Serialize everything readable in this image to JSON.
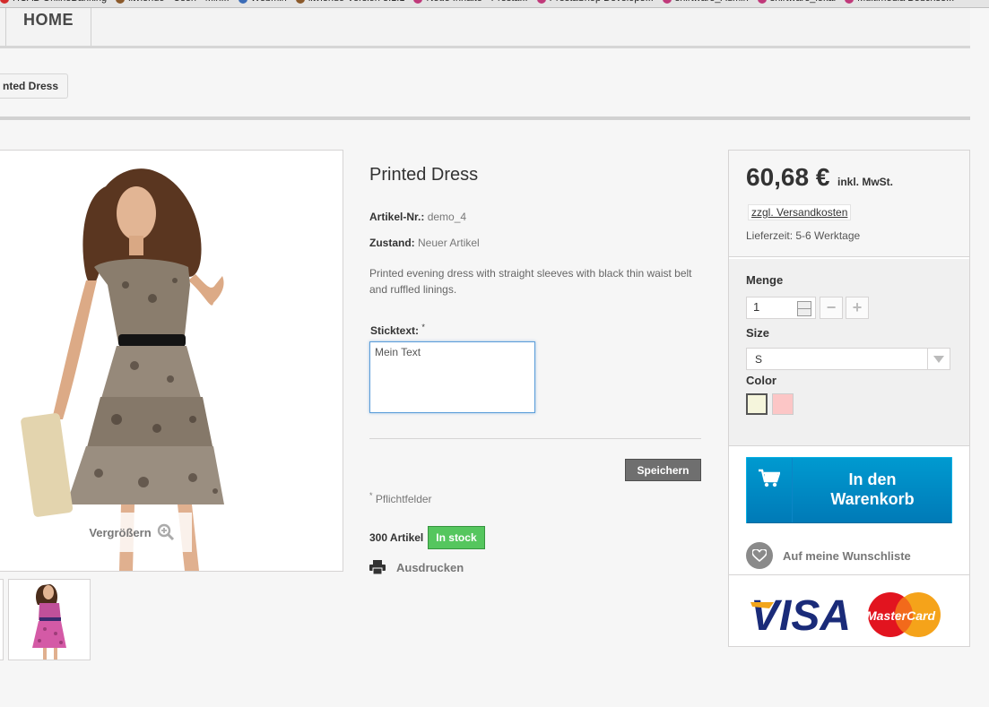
{
  "bookmarks": [
    {
      "label": "HCAB OnlineBanking",
      "color": "#d32b2b"
    },
    {
      "label": "litviendo - Userl - Min...",
      "color": "#8b5a2b"
    },
    {
      "label": "Webmin",
      "color": "#3b6cb7"
    },
    {
      "label": "litviendo Version 3.1.1",
      "color": "#8b5a2b"
    },
    {
      "label": "Neue Inhalte - Presta...",
      "color": "#c0397a"
    },
    {
      "label": "PrestaShop Develope...",
      "color": "#c0397a"
    },
    {
      "label": "shirtware_Admin",
      "color": "#c0397a"
    },
    {
      "label": "shirtware_lokal",
      "color": "#c0397a"
    },
    {
      "label": "Multimedia Bedchse...",
      "color": "#c0397a"
    }
  ],
  "nav": {
    "home_label": "HOME"
  },
  "breadcrumb": {
    "current": "nted Dress"
  },
  "gallery": {
    "zoom_label": "Vergrößern",
    "zoom_icon": "zoom-in-icon"
  },
  "product": {
    "title": "Printed Dress",
    "reference_label": "Artikel-Nr.:",
    "reference_value": "demo_4",
    "condition_label": "Zustand:",
    "condition_value": "Neuer Artikel",
    "description": "Printed evening dress with straight sleeves with black thin waist belt and ruffled linings.",
    "customization_label": "Sticktext:",
    "customization_required_mark": "*",
    "customization_value": "Mein Text",
    "save_label": "Speichern",
    "required_note_mark": "*",
    "required_note": "Pflichtfelder",
    "stock_count": "300 Artikel",
    "stock_status": "In stock",
    "print_label": "Ausdrucken"
  },
  "buybox": {
    "price": "60,68 €",
    "tax_label": "inkl. MwSt.",
    "shipping_link": "zzgl. Versandkosten",
    "delivery_time": "Lieferzeit: 5-6 Werktage",
    "quantity_label": "Menge",
    "quantity_value": "1",
    "size_label": "Size",
    "size_value": "S",
    "color_label": "Color",
    "colors": [
      "#f5f5dc",
      "#fcc6c6"
    ],
    "cart_label_line1": "In den",
    "cart_label_line2": "Warenkorb",
    "wishlist_label": "Auf meine Wunschliste",
    "payment_visa": "VISA",
    "payment_mastercard": "MasterCard"
  }
}
